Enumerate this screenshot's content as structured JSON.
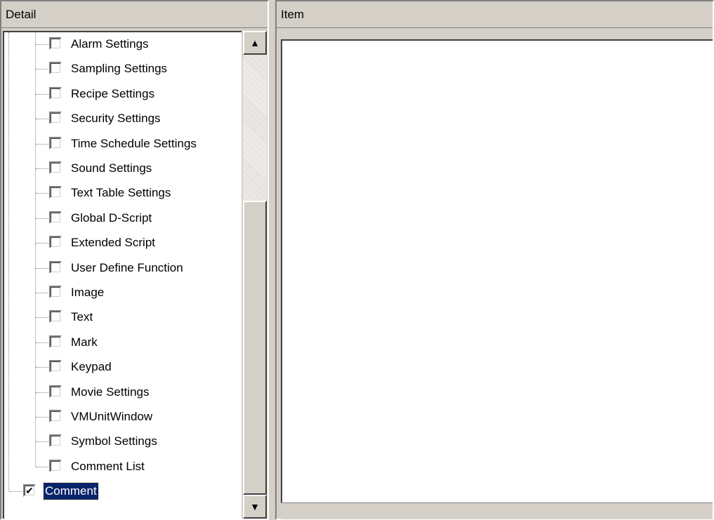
{
  "detail_panel": {
    "header": "Detail",
    "items": [
      {
        "label": "Alarm Settings",
        "checked": false
      },
      {
        "label": "Sampling Settings",
        "checked": false
      },
      {
        "label": "Recipe Settings",
        "checked": false
      },
      {
        "label": "Security Settings",
        "checked": false
      },
      {
        "label": "Time Schedule Settings",
        "checked": false
      },
      {
        "label": "Sound Settings",
        "checked": false
      },
      {
        "label": "Text Table Settings",
        "checked": false
      },
      {
        "label": "Global D-Script",
        "checked": false
      },
      {
        "label": "Extended Script",
        "checked": false
      },
      {
        "label": "User Define Function",
        "checked": false
      },
      {
        "label": "Image",
        "checked": false
      },
      {
        "label": "Text",
        "checked": false
      },
      {
        "label": "Mark",
        "checked": false
      },
      {
        "label": "Keypad",
        "checked": false
      },
      {
        "label": "Movie Settings",
        "checked": false
      },
      {
        "label": "VMUnitWindow",
        "checked": false
      },
      {
        "label": "Symbol Settings",
        "checked": false
      },
      {
        "label": "Comment List",
        "checked": false
      }
    ],
    "root_item": {
      "label": "Comment",
      "checked": true,
      "selected": true
    }
  },
  "item_panel": {
    "header": "Item"
  },
  "icons": {
    "scroll_up": "arrow-up-icon",
    "scroll_down": "arrow-down-icon",
    "check_mark": "check-icon"
  },
  "colors": {
    "selection_bg": "#0a246a",
    "window_bg": "#d4d0c8"
  }
}
